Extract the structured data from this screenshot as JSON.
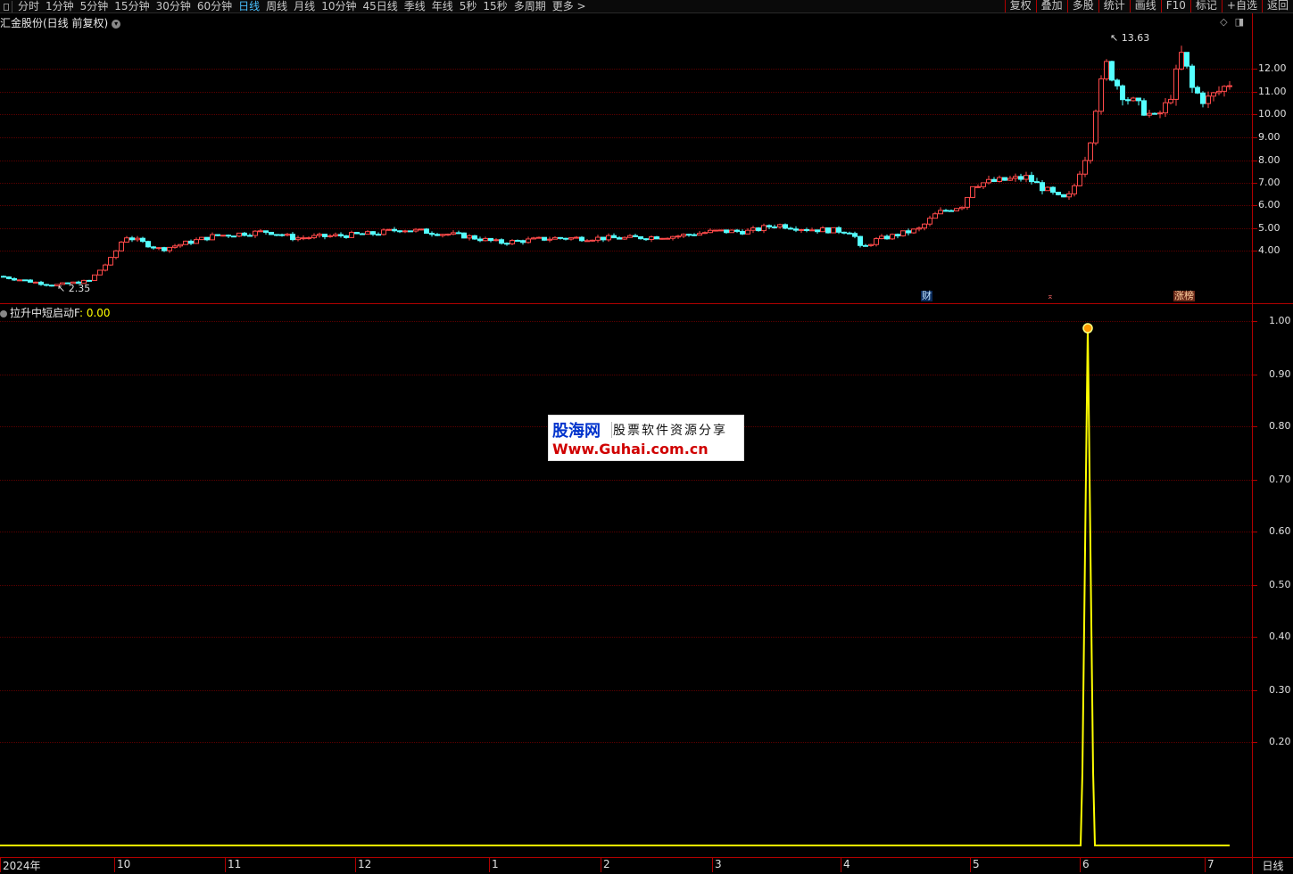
{
  "top_tabs": [
    "分时",
    "1分钟",
    "5分钟",
    "15分钟",
    "30分钟",
    "60分钟",
    "日线",
    "周线",
    "月线",
    "10分钟",
    "45日线",
    "季线",
    "年线",
    "5秒",
    "15秒",
    "多周期",
    "更多 >"
  ],
  "active_tab": "日线",
  "toolbar": [
    "复权",
    "叠加",
    "多股",
    "统计",
    "画线",
    "F10",
    "标记",
    "+自选",
    "返回"
  ],
  "price_panel": {
    "title": "汇金股份(日线 前复权)",
    "high_label": "13.63",
    "low_label": "2.35",
    "y_labels": [
      "12.00",
      "11.00",
      "10.00",
      "9.00",
      "8.00",
      "7.00",
      "6.00",
      "5.00",
      "4.00"
    ],
    "badge_cai": "财",
    "badge_up": "⌅",
    "badge_zhang": "涨榜"
  },
  "indicator_panel": {
    "name": "拉升中短启动F",
    "value_label": ": 0.00",
    "y_labels": [
      "1.00",
      "0.90",
      "0.80",
      "0.70",
      "0.60",
      "0.50",
      "0.40",
      "0.30",
      "0.20"
    ]
  },
  "x_axis": [
    "2024年",
    "10",
    "11",
    "12",
    "1",
    "2",
    "3",
    "4",
    "5",
    "6",
    "7"
  ],
  "status_label": "日线",
  "watermark": {
    "brand": "股海网",
    "slogan": "股票软件资源分享",
    "url": "Www.Guhai.com.cn"
  },
  "colors": {
    "up": "#ff4a4a",
    "down": "#54ffff",
    "signal": "#ffff00",
    "frame": "#b00000"
  },
  "chart_data": {
    "type": "candlestick",
    "ylim": [
      2.0,
      14.0
    ],
    "signal_spike": {
      "value": 1.0,
      "baseline": 0.0,
      "x_month": "6"
    },
    "ohlc_monthly_approx": [
      {
        "month": "2024-09",
        "low": 2.35,
        "high": 3.0
      },
      {
        "month": "10",
        "low": 3.7,
        "high": 5.2
      },
      {
        "month": "11",
        "low": 4.0,
        "high": 5.1
      },
      {
        "month": "12",
        "low": 4.1,
        "high": 5.0
      },
      {
        "month": "1",
        "low": 4.2,
        "high": 4.7
      },
      {
        "month": "2",
        "low": 4.3,
        "high": 4.7
      },
      {
        "month": "3",
        "low": 4.6,
        "high": 5.1
      },
      {
        "month": "4",
        "low": 4.0,
        "high": 4.9
      },
      {
        "month": "5",
        "low": 5.3,
        "high": 7.4
      },
      {
        "month": "6",
        "low": 6.1,
        "high": 13.63
      },
      {
        "month": "7",
        "low": 9.5,
        "high": 13.4
      }
    ]
  }
}
